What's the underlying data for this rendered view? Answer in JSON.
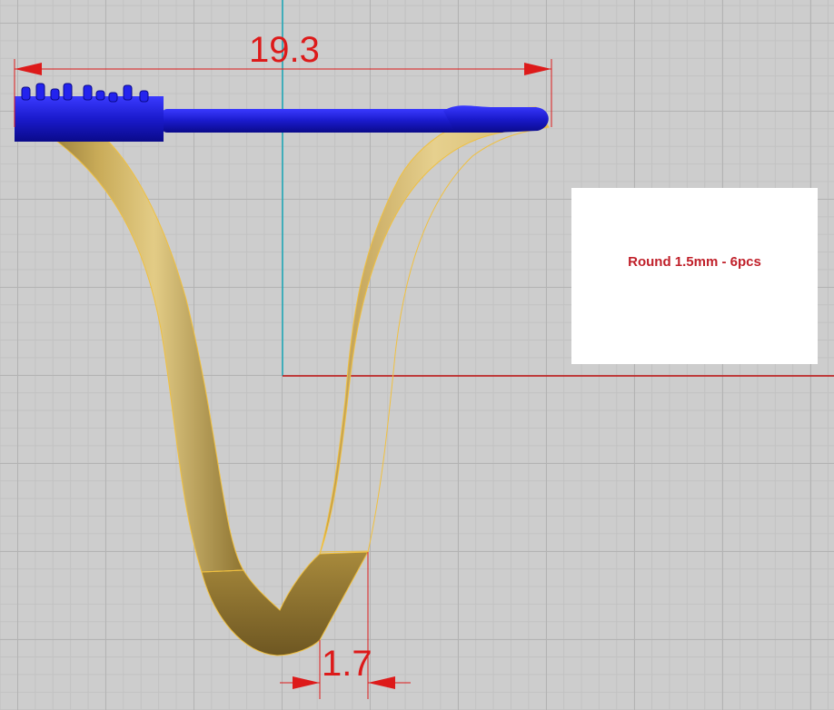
{
  "viewport": {
    "dimensions": {
      "width_label": "19.3",
      "thickness_label": "1.7"
    },
    "colors": {
      "dimension": "#dd1a1a",
      "axis_x": "#c01010",
      "axis_y": "#18a8b8",
      "setting_blue": "#1c1ccc",
      "gold": "#c8a850"
    }
  },
  "info_panel": {
    "text": "Round 1.5mm - 6pcs"
  }
}
